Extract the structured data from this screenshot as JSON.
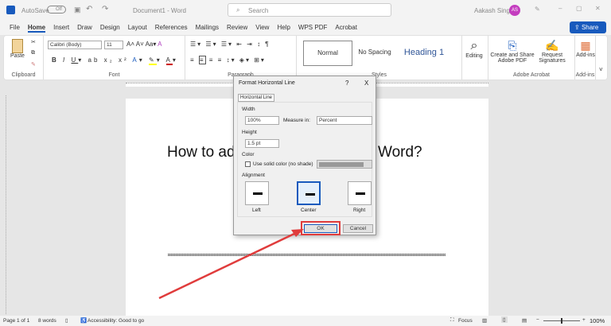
{
  "titlebar": {
    "autosave": "AutoSave",
    "toggle": "Off",
    "doc_title": "Document1 - Word",
    "search_placeholder": "Search",
    "user": "Aakash Singh",
    "initials": "AS"
  },
  "tabs": [
    "File",
    "Home",
    "Insert",
    "Draw",
    "Design",
    "Layout",
    "References",
    "Mailings",
    "Review",
    "View",
    "Help",
    "WPS PDF",
    "Acrobat"
  ],
  "share": "Share",
  "ribbon": {
    "paste": "Paste",
    "clipboard": "Clipboard",
    "font_name": "Calibri (Body)",
    "font_size": "11",
    "font": "Font",
    "paragraph": "Paragraph",
    "styles": [
      "Normal",
      "No Spacing",
      "Heading 1"
    ],
    "styles_label": "Styles",
    "editing": "Editing",
    "create_share": "Create and Share Adobe PDF",
    "request_sig": "Request Signatures",
    "adobe_acrobat": "Adobe Acrobat",
    "addins": "Add-ins",
    "addins_label": "Add-ins"
  },
  "document": {
    "title_left": "How to ad",
    "title_right": "Word?"
  },
  "dialog": {
    "title": "Format Horizontal Line",
    "help": "?",
    "close": "X",
    "tab": "Horizontal Line",
    "width_label": "Width",
    "width_value": "100%",
    "measure_label": "Measure in:",
    "measure_value": "Percent",
    "height_label": "Height",
    "height_value": "1.5 pt",
    "color_label": "Color",
    "solid_color": "Use solid color (no shade)",
    "alignment_label": "Alignment",
    "align": [
      "Left",
      "Center",
      "Right"
    ],
    "ok": "OK",
    "cancel": "Cancel"
  },
  "status": {
    "page": "Page 1 of 1",
    "words": "8 words",
    "accessibility": "Accessibility: Good to go",
    "focus": "Focus",
    "zoom": "100%"
  },
  "colors": {
    "accent": "#185abd",
    "highlight": "#e03c3c"
  }
}
